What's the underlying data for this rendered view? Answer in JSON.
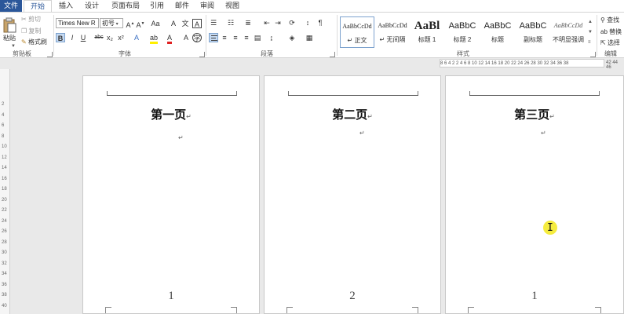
{
  "tabs": [
    "文件",
    "开始",
    "插入",
    "设计",
    "页面布局",
    "引用",
    "邮件",
    "审阅",
    "视图"
  ],
  "clipboard": {
    "paste": "粘贴",
    "cut": "剪切",
    "copy": "复制",
    "format_painter": "格式刷",
    "group": "剪贴板"
  },
  "font": {
    "name": "Times New R",
    "size": "初号",
    "clear_glyph": "Aa",
    "bold": "B",
    "italic": "I",
    "underline": "U",
    "strike": "abc",
    "sub": "x₂",
    "sup": "x²",
    "group": "字体"
  },
  "paragraph": {
    "group": "段落"
  },
  "styles": {
    "items": [
      {
        "sample": "AaBbCcDd",
        "name": "↵ 正文"
      },
      {
        "sample": "AaBbCcDd",
        "name": "↵ 无间隔"
      },
      {
        "sample": "AaBl",
        "name": "标题 1"
      },
      {
        "sample": "AaBbC",
        "name": "标题 2"
      },
      {
        "sample": "AaBbC",
        "name": "标题"
      },
      {
        "sample": "AaBbC",
        "name": "副标题"
      },
      {
        "sample": "AaBbCcDd",
        "name": "不明显强调"
      }
    ],
    "group": "样式"
  },
  "editing": {
    "find": "查找",
    "replace": "替换",
    "select": "选择",
    "group": "编辑"
  },
  "ruler": {
    "horizontal": "8 6 4 2  2 4 6 8 10 12 14 16 18 20 22 24 26 28 30 32 34 36 38",
    "right_marks": "42 44 46",
    "vertical": [
      "2",
      "4",
      "6",
      "8",
      "10",
      "12",
      "14",
      "16",
      "18",
      "20",
      "22",
      "24",
      "26",
      "28",
      "30",
      "32",
      "34",
      "36",
      "38",
      "40"
    ]
  },
  "pages": [
    {
      "title": "第一页",
      "number": "1"
    },
    {
      "title": "第二页",
      "number": "2"
    },
    {
      "title": "第三页",
      "number": "1"
    }
  ],
  "para_mark": "↵"
}
